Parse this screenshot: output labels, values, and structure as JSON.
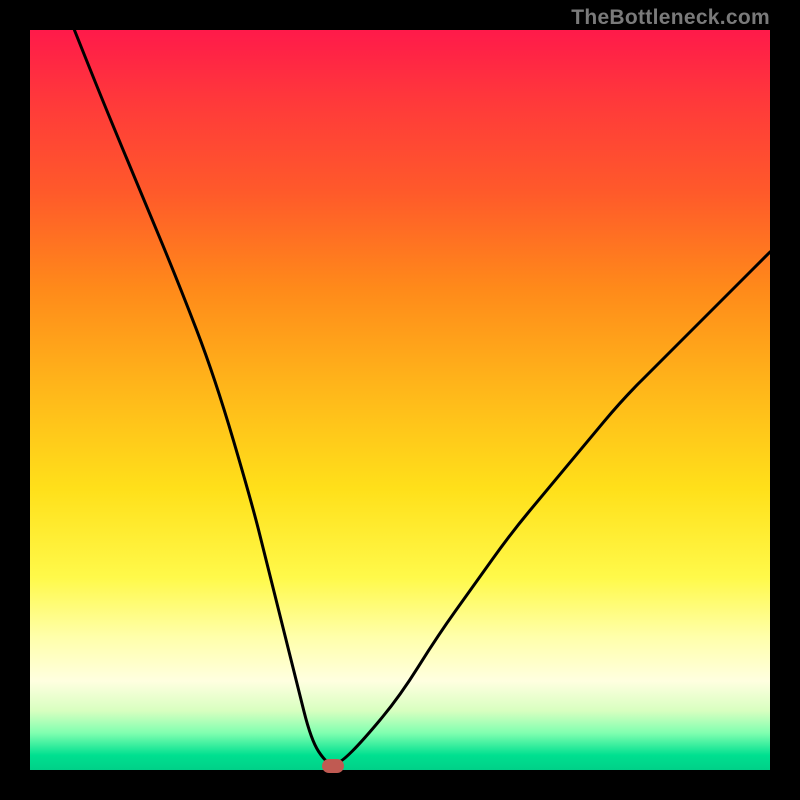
{
  "watermark": "TheBottleneck.com",
  "chart_data": {
    "type": "line",
    "title": "",
    "xlabel": "",
    "ylabel": "",
    "xlim": [
      0,
      100
    ],
    "ylim": [
      0,
      100
    ],
    "series": [
      {
        "name": "curve",
        "x": [
          6,
          10,
          15,
          20,
          25,
          30,
          32,
          34,
          36,
          38,
          40,
          41,
          42,
          45,
          50,
          55,
          60,
          65,
          70,
          75,
          80,
          85,
          90,
          95,
          100
        ],
        "values": [
          100,
          90,
          78,
          66,
          53,
          36,
          28,
          20,
          12,
          4,
          1,
          1,
          1,
          4,
          10,
          18,
          25,
          32,
          38,
          44,
          50,
          55,
          60,
          65,
          70
        ]
      }
    ],
    "marker": {
      "x": 41,
      "y": 0.5
    },
    "gradient_colors": {
      "top": "#ff1a4a",
      "mid_upper": "#ff8a1a",
      "mid": "#ffe01a",
      "mid_lower": "#ffffe0",
      "bottom": "#00d088"
    }
  }
}
